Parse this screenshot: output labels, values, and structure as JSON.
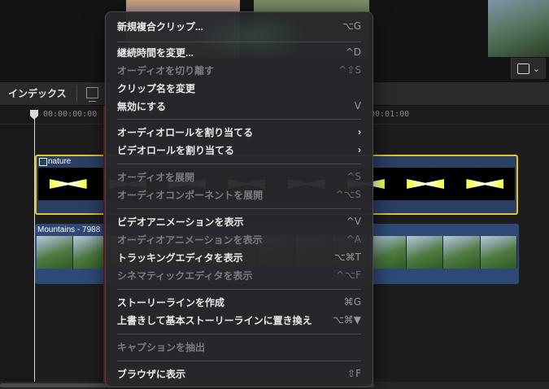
{
  "toolbar": {
    "index_label": "インデックス"
  },
  "timeline": {
    "timecode_left": "00:00:00:00",
    "timecode_right": "00:01:00",
    "clips": [
      {
        "name": "nature"
      },
      {
        "name": "Mountains - 7988"
      }
    ],
    "nature_marker": "~"
  },
  "menu": {
    "items": [
      {
        "label": "新規複合クリップ...",
        "shortcut": "⌥G",
        "disabled": false
      },
      {
        "label": "継続時間を変更...",
        "shortcut": "^D",
        "disabled": false
      },
      {
        "label": "オーディオを切り離す",
        "shortcut": "^⇧S",
        "disabled": true
      },
      {
        "label": "クリップ名を変更",
        "shortcut": "",
        "disabled": false
      },
      {
        "label": "無効にする",
        "shortcut": "V",
        "disabled": false
      },
      {
        "label": "オーディオロールを割り当てる",
        "shortcut": "",
        "submenu": true,
        "disabled": false
      },
      {
        "label": "ビデオロールを割り当てる",
        "shortcut": "",
        "submenu": true,
        "disabled": false
      },
      {
        "label": "オーディオを展開",
        "shortcut": "^S",
        "disabled": true
      },
      {
        "label": "オーディオコンポーネントを展開",
        "shortcut": "^⌥S",
        "disabled": true
      },
      {
        "label": "ビデオアニメーションを表示",
        "shortcut": "^V",
        "disabled": false
      },
      {
        "label": "オーディオアニメーションを表示",
        "shortcut": "^A",
        "disabled": true
      },
      {
        "label": "トラッキングエディタを表示",
        "shortcut": "⌥⌘T",
        "disabled": false
      },
      {
        "label": "シネマティックエディタを表示",
        "shortcut": "^⌥F",
        "disabled": true
      },
      {
        "label": "ストーリーラインを作成",
        "shortcut": "⌘G",
        "disabled": false
      },
      {
        "label": "上書きして基本ストーリーラインに置き換え",
        "shortcut": "⌥⌘▼",
        "disabled": false
      },
      {
        "label": "キャプションを抽出",
        "shortcut": "",
        "disabled": true
      },
      {
        "label": "ブラウザに表示",
        "shortcut": "⇧F",
        "disabled": false
      }
    ]
  }
}
